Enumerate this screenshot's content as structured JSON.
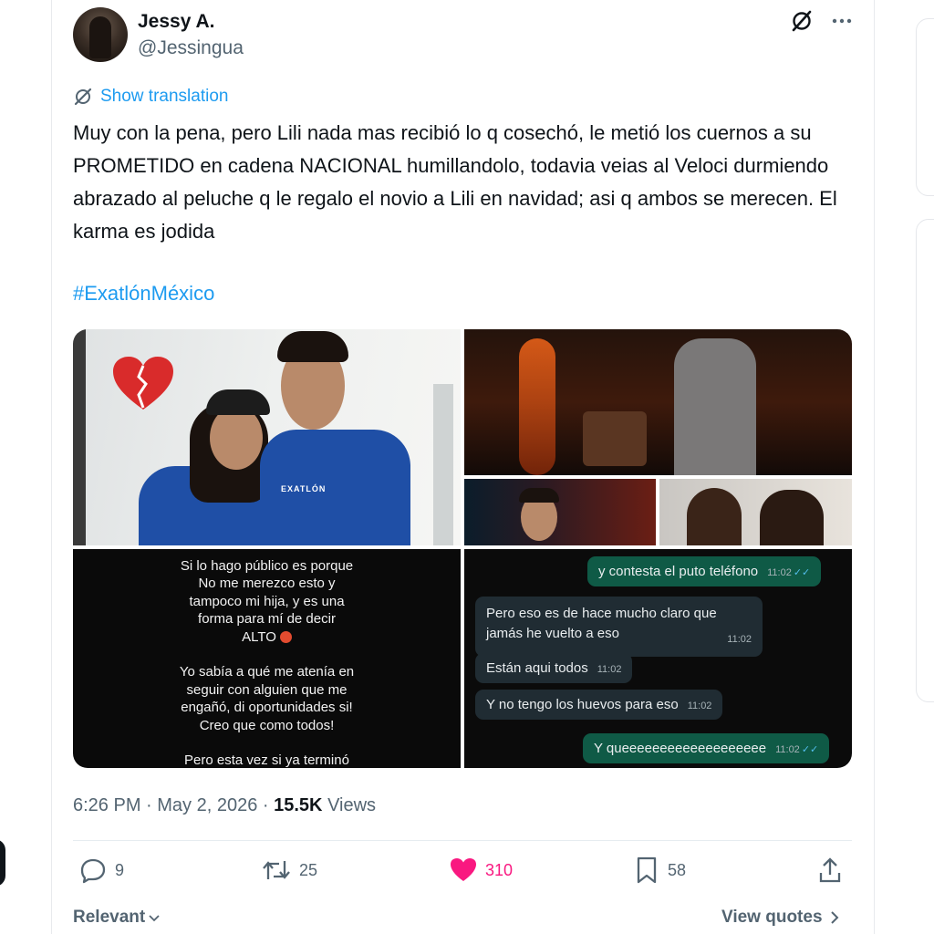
{
  "author": {
    "name": "Jessy A.",
    "handle": "@Jessingua"
  },
  "translate": {
    "label": "Show translation"
  },
  "tweet": {
    "text": "Muy con la pena, pero Lili nada mas recibió lo q cosechó, le metió los cuernos a su PROMETIDO en cadena NACIONAL humillandolo, todavia veias al Veloci durmiendo abrazado al peluche q le regalo el novio a Lili en navidad; asi q ambos se merecen. El karma es jodida",
    "hashtag": "#ExatlónMéxico"
  },
  "media": {
    "shirt_logo": "EXATLÓN",
    "story_lines": [
      "Si lo hago público es porque",
      "No me merezco esto y",
      "tampoco mi hija, y es una",
      "forma para mí de decir",
      "ALTO",
      "",
      "Yo sabía a qué me atenía en",
      "seguir con alguien que me",
      "engañó, di oportunidades si!",
      "Creo que como todos!",
      "",
      "Pero esta vez si ya terminó"
    ],
    "chat": [
      {
        "text": "y contesta el puto teléfono",
        "time": "11:02",
        "direction": "out"
      },
      {
        "text": "Pero eso es de hace mucho claro que jamás he vuelto a eso",
        "time": "11:02",
        "direction": "in"
      },
      {
        "text": "Están aqui todos",
        "time": "11:02",
        "direction": "in"
      },
      {
        "text": "Y no tengo los huevos para eso",
        "time": "11:02",
        "direction": "in"
      },
      {
        "text": "Y queeeeeeeeeeeeeeeeeee",
        "time": "11:02",
        "direction": "out"
      }
    ]
  },
  "meta": {
    "time": "6:26 PM",
    "date": "May 2, 2026",
    "views_count": "15.5K",
    "views_label": "Views"
  },
  "actions": {
    "replies": "9",
    "reposts": "25",
    "likes": "310",
    "bookmarks": "58"
  },
  "footer": {
    "sort_label": "Relevant",
    "quotes_label": "View quotes"
  },
  "colors": {
    "accent": "#1d9bf0",
    "like": "#f91880",
    "secondary_text": "#536471"
  }
}
